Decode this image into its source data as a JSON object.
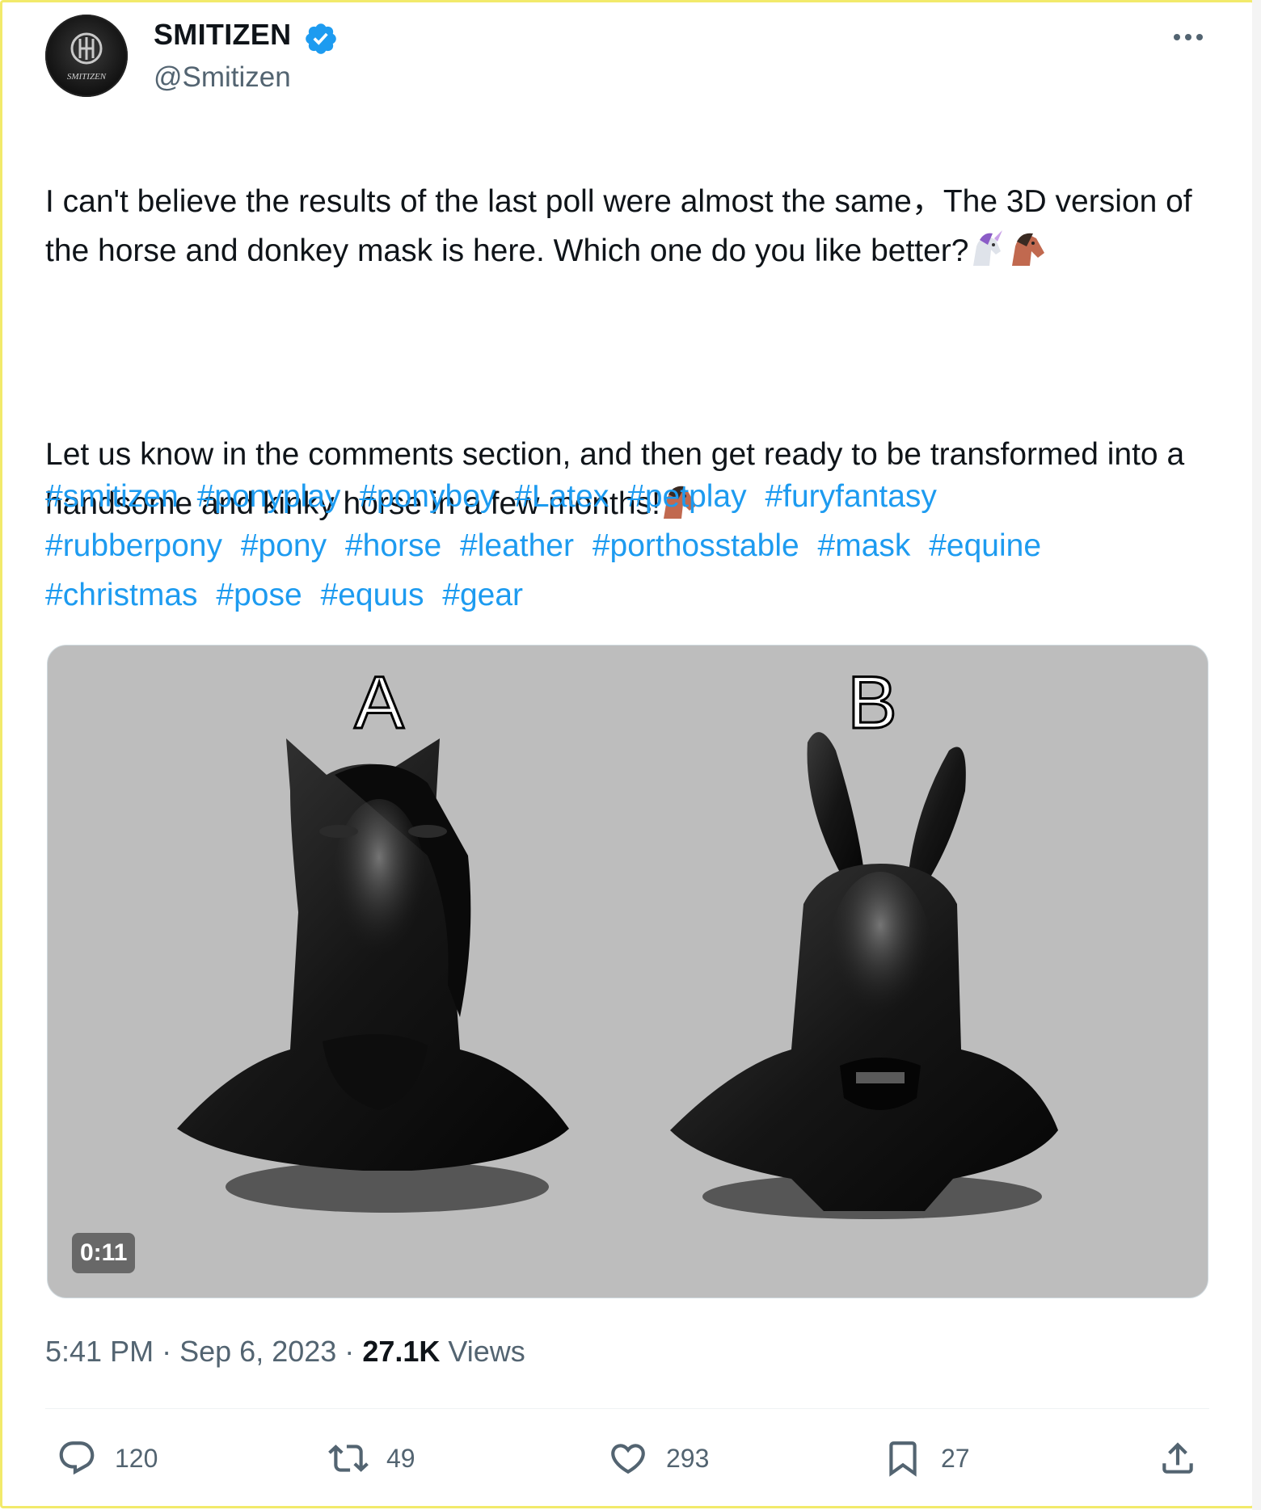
{
  "author": {
    "display_name": "SMITIZEN",
    "handle": "@Smitizen",
    "avatar_text": "SMITIZEN",
    "verified": true
  },
  "tweet": {
    "text_p1": "I can't believe the results of the last poll were almost the same，The 3D version of the horse and donkey mask is here. Which one do you like better?",
    "text_p2": "Let us know in the comments section, and then get ready to be transformed into a handsome and kinky horse in a few months!",
    "hashtags": [
      "#smitizen",
      "#ponyplay",
      "#ponyboy",
      "#Latex",
      "#petplay",
      "#furyfantasy",
      "#rubberpony",
      "#pony",
      "#horse",
      "#leather",
      "#porthosstable",
      "#mask",
      "#equine",
      "#christmas",
      "#pose",
      "#equus",
      "#gear"
    ]
  },
  "media": {
    "label_a": "A",
    "label_b": "B",
    "duration": "0:11"
  },
  "meta": {
    "time": "5:41 PM",
    "separator": "·",
    "date": "Sep 6, 2023",
    "views_count": "27.1K",
    "views_label": "Views"
  },
  "actions": {
    "reply_count": "120",
    "retweet_count": "49",
    "like_count": "293",
    "bookmark_count": "27"
  },
  "colors": {
    "link": "#1d9bf0",
    "secondary_text": "#536471",
    "verified": "#1d9bf0",
    "frame_border": "#f2ea6b"
  },
  "icons": [
    "verified-badge-icon",
    "more-icon",
    "unicorn-emoji",
    "horse-emoji",
    "reply-icon",
    "retweet-icon",
    "like-icon",
    "bookmark-icon",
    "share-icon"
  ]
}
